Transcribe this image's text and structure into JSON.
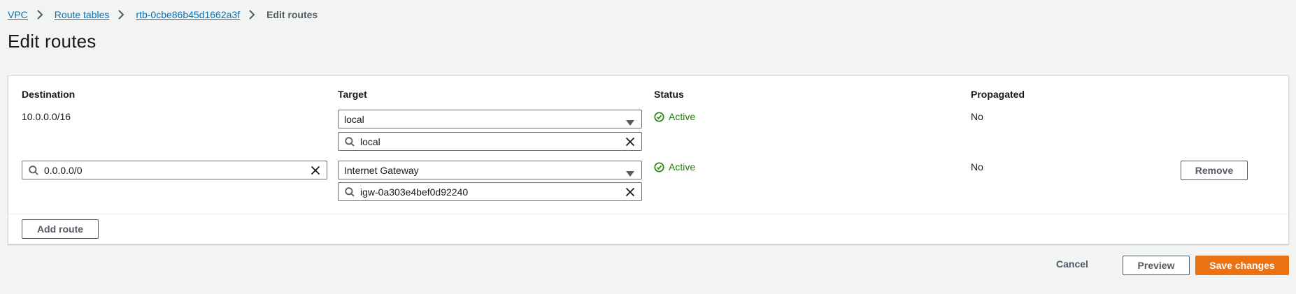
{
  "breadcrumb": {
    "items": [
      "VPC",
      "Route tables",
      "rtb-0cbe86b45d1662a3f"
    ],
    "current": "Edit routes"
  },
  "page": {
    "title": "Edit routes"
  },
  "table": {
    "headers": {
      "destination": "Destination",
      "target": "Target",
      "status": "Status",
      "propagated": "Propagated"
    },
    "rows": [
      {
        "destination": "10.0.0.0/16",
        "target_type": "local",
        "target_search": "local",
        "status": "Active",
        "propagated": "No"
      },
      {
        "destination": "0.0.0.0/0",
        "target_type": "Internet Gateway",
        "target_search": "igw-0a303e4bef0d92240",
        "status": "Active",
        "propagated": "No",
        "remove_label": "Remove"
      }
    ],
    "add_route_label": "Add route"
  },
  "footer": {
    "cancel_label": "Cancel",
    "preview_label": "Preview",
    "save_label": "Save changes"
  },
  "colors": {
    "link": "#0073bb",
    "status_active": "#1d8102",
    "primary": "#ec7211",
    "background": "#f2f3f3"
  },
  "icons": {
    "breadcrumb_separator": "chevron-right-icon",
    "status": "check-circle-icon",
    "select": "caret-down-icon",
    "search": "search-icon",
    "clear": "close-icon"
  }
}
